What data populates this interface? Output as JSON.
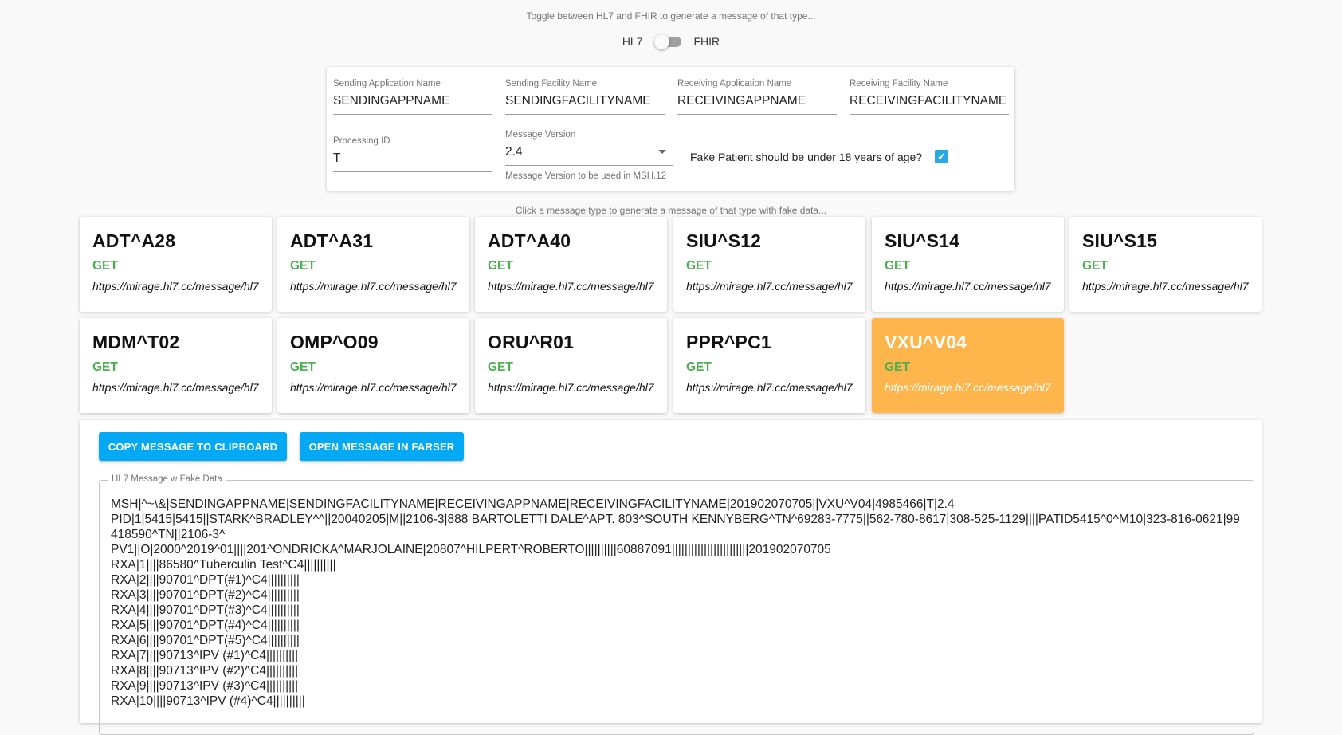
{
  "toggle": {
    "hint": "Toggle between HL7 and FHIR to generate a message of that type...",
    "left_label": "HL7",
    "right_label": "FHIR",
    "value": "HL7"
  },
  "form": {
    "sending_app": {
      "label": "Sending Application Name",
      "value": "SENDINGAPPNAME"
    },
    "sending_facility": {
      "label": "Sending Facility Name",
      "value": "SENDINGFACILITYNAME"
    },
    "receiving_app": {
      "label": "Receiving Application Name",
      "value": "RECEIVINGAPPNAME"
    },
    "receiving_facility": {
      "label": "Receiving Facility Name",
      "value": "RECEIVINGFACILITYNAME"
    },
    "processing_id": {
      "label": "Processing ID",
      "value": "T"
    },
    "message_version": {
      "label": "Message Version",
      "value": "2.4",
      "helper": "Message Version to be used in MSH.12"
    },
    "under18": {
      "label": "Fake Patient should be under 18 years of age?",
      "checked": true
    }
  },
  "message_types": {
    "hint": "Click a message type to generate a message of that type with fake data...",
    "cards": [
      {
        "title": "ADT^A28",
        "method": "GET",
        "url": "https://mirage.hl7.cc/message/hl7"
      },
      {
        "title": "ADT^A31",
        "method": "GET",
        "url": "https://mirage.hl7.cc/message/hl7"
      },
      {
        "title": "ADT^A40",
        "method": "GET",
        "url": "https://mirage.hl7.cc/message/hl7"
      },
      {
        "title": "SIU^S12",
        "method": "GET",
        "url": "https://mirage.hl7.cc/message/hl7"
      },
      {
        "title": "SIU^S14",
        "method": "GET",
        "url": "https://mirage.hl7.cc/message/hl7"
      },
      {
        "title": "SIU^S15",
        "method": "GET",
        "url": "https://mirage.hl7.cc/message/hl7"
      },
      {
        "title": "MDM^T02",
        "method": "GET",
        "url": "https://mirage.hl7.cc/message/hl7"
      },
      {
        "title": "OMP^O09",
        "method": "GET",
        "url": "https://mirage.hl7.cc/message/hl7"
      },
      {
        "title": "ORU^R01",
        "method": "GET",
        "url": "https://mirage.hl7.cc/message/hl7"
      },
      {
        "title": "PPR^PC1",
        "method": "GET",
        "url": "https://mirage.hl7.cc/message/hl7"
      },
      {
        "title": "VXU^V04",
        "method": "GET",
        "url": "https://mirage.hl7.cc/message/hl7",
        "active": true
      }
    ]
  },
  "output": {
    "copy_button": "COPY MESSAGE TO CLIPBOARD",
    "farser_button": "OPEN MESSAGE IN FARSER",
    "message_label": "HL7 Message w Fake Data",
    "lines": [
      "MSH|^~\\&|SENDINGAPPNAME|SENDINGFACILITYNAME|RECEIVINGAPPNAME|RECEIVINGFACILITYNAME|201902070705||VXU^V04|4985466|T|2.4",
      "PID|1|5415|5415||STARK^BRADLEY^^||20040205|M||2106-3|888 BARTOLETTI DALE^APT. 803^SOUTH KENNYBERG^TN^69283-7775||562-780-8617|308-525-1129||||PATID5415^0^M10|323-816-0621|99418590^TN||2106-3^",
      "PV1||O|2000^2019^01||||201^ONDRICKA^MARJOLAINE|20807^HILPERT^ROBERTO||||||||||60887091||||||||||||||||||||||||201902070705",
      "RXA|1||||86580^Tuberculin Test^C4||||||||||",
      "RXA|2||||90701^DPT(#1)^C4||||||||||",
      "RXA|3||||90701^DPT(#2)^C4||||||||||",
      "RXA|4||||90701^DPT(#3)^C4||||||||||",
      "RXA|5||||90701^DPT(#4)^C4||||||||||",
      "RXA|6||||90701^DPT(#5)^C4||||||||||",
      "RXA|7||||90713^IPV (#1)^C4||||||||||",
      "RXA|8||||90713^IPV (#2)^C4||||||||||",
      "RXA|9||||90713^IPV (#3)^C4||||||||||",
      "RXA|10||||90713^IPV (#4)^C4||||||||||"
    ]
  }
}
